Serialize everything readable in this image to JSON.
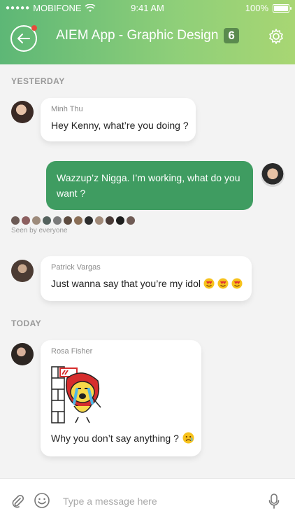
{
  "status_bar": {
    "carrier": "MOBIFONE",
    "time": "9:41 AM",
    "battery": "100%"
  },
  "header": {
    "title": "AIEM App - Graphic Design",
    "count": "6"
  },
  "sections": {
    "yesterday": "YESTERDAY",
    "today": "TODAY"
  },
  "messages": [
    {
      "sender": "Minh Thu",
      "text": "Hey Kenny, what’re you doing ?"
    },
    {
      "sender": "",
      "text_line1": "Wazzup’z Nigga. I’m working, what do you",
      "text_line2": "want ?"
    },
    {
      "sender": "Patrick Vargas",
      "text": "Just wanna say that you’re my idol"
    },
    {
      "sender": "Rosa Fisher",
      "text": "Why you don’t say anything ?"
    }
  ],
  "seen": {
    "label": "Seen by everyone"
  },
  "composer": {
    "placeholder": "Type a message here"
  },
  "colors": {
    "accent": "#3f9c61",
    "header_start": "#5db776",
    "header_end": "#a8d673"
  },
  "icons": [
    "back-arrow-icon",
    "gear-icon",
    "paperclip-icon",
    "emoji-icon",
    "microphone-icon",
    "wifi-icon",
    "battery-icon"
  ]
}
